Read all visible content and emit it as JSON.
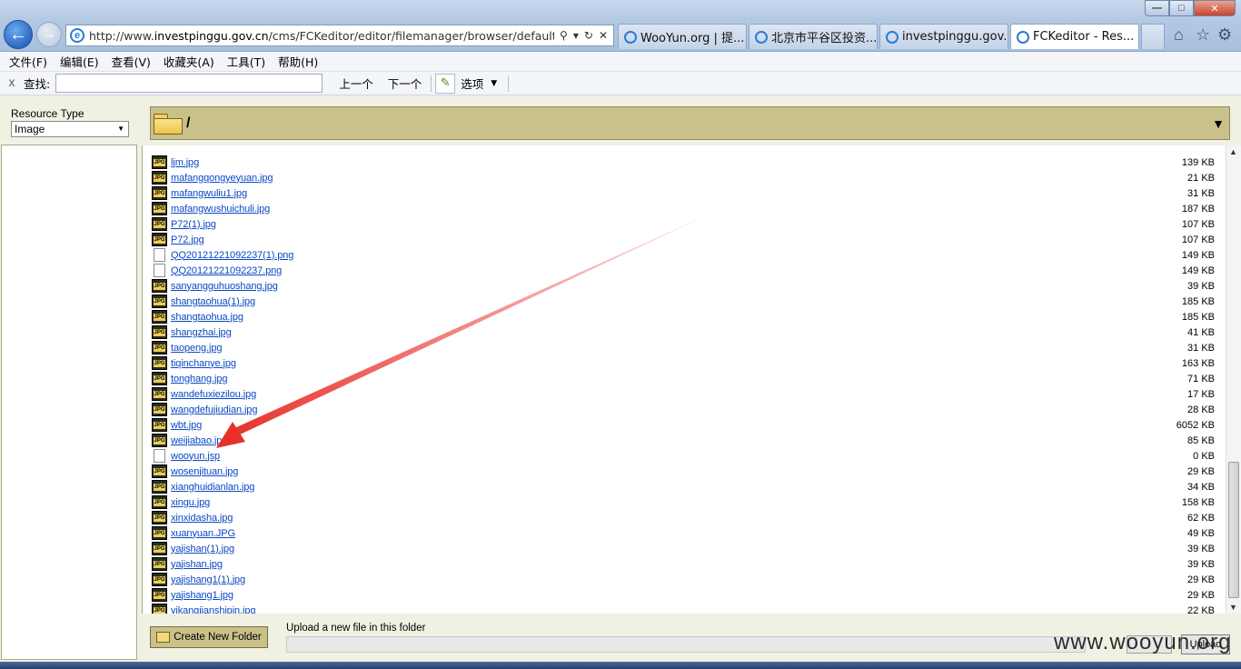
{
  "browser": {
    "address_url_prefix": "http://www.",
    "address_url_host": "investpinggu.gov.cn",
    "address_url_rest": "/cms/FCKeditor/editor/filemanager/browser/default/b",
    "tabs": [
      {
        "label": "WooYun.org | 提...",
        "active": false
      },
      {
        "label": "北京市平谷区投资...",
        "active": false
      },
      {
        "label": "investpinggu.gov.cn",
        "active": false
      },
      {
        "label": "FCKeditor - Res...",
        "active": true
      }
    ],
    "tab_close_glyph": "×"
  },
  "menubar": {
    "items": [
      "文件(F)",
      "编辑(E)",
      "查看(V)",
      "收藏夹(A)",
      "工具(T)",
      "帮助(H)"
    ]
  },
  "findbar": {
    "close_glyph": "x",
    "label": "查找:",
    "value": "",
    "prev_label": "上一个",
    "next_label": "下一个",
    "options_label": "选项"
  },
  "fckeditor": {
    "resource_type_label": "Resource Type",
    "resource_type_value": "Image",
    "current_path": "/",
    "files": [
      {
        "name": "ljm.jpg",
        "size": "139 KB",
        "type": "jpg"
      },
      {
        "name": "mafangqongyeyuan.jpg",
        "size": "21 KB",
        "type": "jpg"
      },
      {
        "name": "mafangwuliu1.jpg",
        "size": "31 KB",
        "type": "jpg"
      },
      {
        "name": "mafangwushuichuli.jpg",
        "size": "187 KB",
        "type": "jpg"
      },
      {
        "name": "P72(1).jpg",
        "size": "107 KB",
        "type": "jpg"
      },
      {
        "name": "P72.jpg",
        "size": "107 KB",
        "type": "jpg"
      },
      {
        "name": "QQ20121221092237(1).png",
        "size": "149 KB",
        "type": "doc"
      },
      {
        "name": "QQ20121221092237.png",
        "size": "149 KB",
        "type": "doc"
      },
      {
        "name": "sanyangguhuoshang.jpg",
        "size": "39 KB",
        "type": "jpg"
      },
      {
        "name": "shangtaohua(1).jpg",
        "size": "185 KB",
        "type": "jpg"
      },
      {
        "name": "shangtaohua.jpg",
        "size": "185 KB",
        "type": "jpg"
      },
      {
        "name": "shangzhai.jpg",
        "size": "41 KB",
        "type": "jpg"
      },
      {
        "name": "taopeng.jpg",
        "size": "31 KB",
        "type": "jpg"
      },
      {
        "name": "tiqinchanye.jpg",
        "size": "163 KB",
        "type": "jpg"
      },
      {
        "name": "tonghang.jpg",
        "size": "71 KB",
        "type": "jpg"
      },
      {
        "name": "wandefuxiezilou.jpg",
        "size": "17 KB",
        "type": "jpg"
      },
      {
        "name": "wangdefujiudian.jpg",
        "size": "28 KB",
        "type": "jpg"
      },
      {
        "name": "wbt.jpg",
        "size": "6052 KB",
        "type": "jpg"
      },
      {
        "name": "weijiabao.jpg",
        "size": "85 KB",
        "type": "jpg"
      },
      {
        "name": "wooyun.jsp",
        "size": "0 KB",
        "type": "doc"
      },
      {
        "name": "wosenjituan.jpg",
        "size": "29 KB",
        "type": "jpg"
      },
      {
        "name": "xianghuidianlan.jpg",
        "size": "34 KB",
        "type": "jpg"
      },
      {
        "name": "xingu.jpg",
        "size": "158 KB",
        "type": "jpg"
      },
      {
        "name": "xinxidasha.jpg",
        "size": "62 KB",
        "type": "jpg"
      },
      {
        "name": "xuanyuan.JPG",
        "size": "49 KB",
        "type": "jpg"
      },
      {
        "name": "yajishan(1).jpg",
        "size": "39 KB",
        "type": "jpg"
      },
      {
        "name": "yajishan.jpg",
        "size": "39 KB",
        "type": "jpg"
      },
      {
        "name": "yajishang1(1).jpg",
        "size": "29 KB",
        "type": "jpg"
      },
      {
        "name": "yajishang1.jpg",
        "size": "29 KB",
        "type": "jpg"
      },
      {
        "name": "yikangjianshipin.jpg",
        "size": "22 KB",
        "type": "jpg"
      }
    ],
    "create_folder_label": "Create New Folder",
    "upload_label": "Upload a new file in this folder",
    "upload_button_label": "Upload"
  },
  "watermark": "www.wooyun.org",
  "colors": {
    "annotation_arrow": "#e8302a",
    "link": "#0a48c4",
    "panel": "#c9c188"
  }
}
